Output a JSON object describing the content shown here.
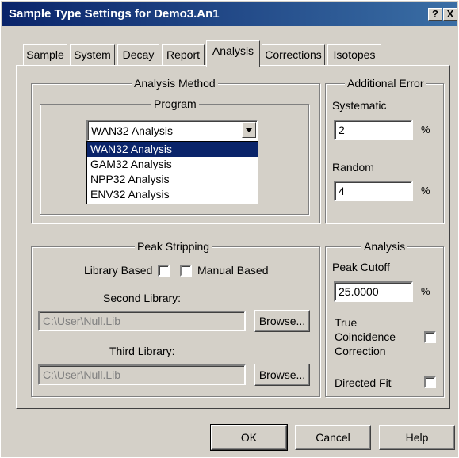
{
  "window": {
    "title": "Sample Type Settings for Demo3.An1",
    "help_btn": "?",
    "close_btn": "X"
  },
  "tabs": [
    {
      "label": "Sample"
    },
    {
      "label": "System"
    },
    {
      "label": "Decay"
    },
    {
      "label": "Report"
    },
    {
      "label": "Analysis"
    },
    {
      "label": "Corrections"
    },
    {
      "label": "Isotopes"
    }
  ],
  "active_tab": "Analysis",
  "analysis_method": {
    "legend": "Analysis Method",
    "program_legend": "Program",
    "selected": "WAN32 Analysis",
    "options": [
      "WAN32 Analysis",
      "GAM32 Analysis",
      "NPP32 Analysis",
      "ENV32 Analysis"
    ],
    "highlighted_option": "WAN32 Analysis"
  },
  "additional_error": {
    "legend": "Additional Error",
    "systematic_label": "Systematic",
    "systematic_value": "2",
    "random_label": "Random",
    "random_value": "4",
    "percent": "%"
  },
  "peak_stripping": {
    "legend": "Peak Stripping",
    "library_based_label": "Library Based",
    "library_based_checked": false,
    "manual_based_label": "Manual Based",
    "manual_based_checked": false,
    "second_library_label": "Second Library:",
    "second_library_value": "C:\\User\\Null.Lib",
    "third_library_label": "Third Library:",
    "third_library_value": "C:\\User\\Null.Lib",
    "browse_label": "Browse..."
  },
  "analysis": {
    "legend": "Analysis",
    "peak_cutoff_label": "Peak Cutoff",
    "peak_cutoff_value": "25.0000",
    "percent": "%",
    "tcc_line1": "True",
    "tcc_line2": "Coincidence",
    "tcc_line3": "Correction",
    "tcc_checked": false,
    "directed_fit_label": "Directed Fit",
    "directed_fit_checked": false
  },
  "buttons": {
    "ok": "OK",
    "cancel": "Cancel",
    "help": "Help"
  }
}
